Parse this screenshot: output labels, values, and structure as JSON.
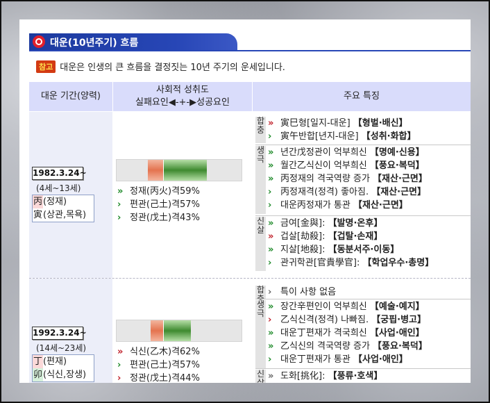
{
  "title": "대운(10년주기) 흐름",
  "note": {
    "badge": "참고",
    "text": "대운은 인생의 큰 흐름을 결정짓는 10년 주기의 운세입니다."
  },
  "headers": {
    "period": "대운 기간(양력)",
    "social_line1": "사회적 성취도",
    "social_line2": "실패요인◀-+-▶성공요인",
    "features": "주요 특징"
  },
  "colors": {
    "title_blue": "#2746b6",
    "header_bg": "#d9dcfb",
    "green": "#1f8a2a",
    "red": "#c0202a"
  },
  "decades": [
    {
      "date": "1982.3.24~",
      "age": "(4세~13세)",
      "pillars": [
        {
          "char": "丙",
          "rest": "(정재)",
          "char_bg": "#fbd9d9"
        },
        {
          "char": "寅",
          "rest": "(상관,목욕)",
          "char_bg": "#ffffff"
        }
      ],
      "achievement": {
        "fail_level": 0.12,
        "success_level": 0.55
      },
      "yukchin": [
        {
          "chev": "green2",
          "text": "정재(丙火)격59%"
        },
        {
          "chev": "green1",
          "text": "편관(己土)격57%"
        },
        {
          "chev": "green1",
          "text": "정관(戊土)격43%"
        }
      ],
      "groups": [
        {
          "label": [
            "합",
            "충"
          ],
          "rows": [
            {
              "chev": "red2",
              "text": "寅巳형[일지-대운] ",
              "tag": "【형벌·배신】"
            },
            {
              "chev": "green1",
              "text": "寅午반합[년지-대운] ",
              "tag": "【성취·화합】"
            }
          ]
        },
        {
          "label": [
            "생",
            "극"
          ],
          "rows": [
            {
              "chev": "green2",
              "text": "년간戊정관이 억부희신 ",
              "tag": "【명예·신용】"
            },
            {
              "chev": "green2",
              "text": "월간乙식신이 억부희신 ",
              "tag": "【풍요·복덕】"
            },
            {
              "chev": "green2",
              "text": "丙정재의 격국역량 증가 ",
              "tag": "【재산·근면】"
            },
            {
              "chev": "green1",
              "text": "丙정재격(정격) 좋아짐. ",
              "tag": "【재산·근면】"
            },
            {
              "chev": "green1",
              "text": "대운丙정재가 통관 ",
              "tag": "【재산·근면】"
            }
          ]
        },
        {
          "label": [
            "신",
            "살"
          ],
          "rows": [
            {
              "chev": "green2",
              "text": "금여[金與]: ",
              "tag": "【발명·온후】"
            },
            {
              "chev": "red2",
              "text": "겁살[劫殺]: ",
              "tag": "【겁탈·손재】"
            },
            {
              "chev": "green2",
              "text": "지살[地殺]: ",
              "tag": "【동분서주·이동】"
            },
            {
              "chev": "green1",
              "text": "관귀학관[官貴學官]: ",
              "tag": "【학업우수·총명】"
            }
          ]
        }
      ]
    },
    {
      "date": "1992.3.24~",
      "age": "(14세~23세)",
      "pillars": [
        {
          "char": "丁",
          "rest": "(편재)",
          "char_bg": "#fbd9d9"
        },
        {
          "char": "卯",
          "rest": "(식신,장생)",
          "char_bg": "#d7f1dc"
        }
      ],
      "achievement": {
        "fail_level": 0.1,
        "success_level": 0.35
      },
      "yukchin": [
        {
          "chev": "red2",
          "text": "식신(乙木)격62%"
        },
        {
          "chev": "green1",
          "text": "편관(己土)격57%"
        },
        {
          "chev": "red1",
          "text": "정관(戊土)격44%"
        }
      ],
      "groups": [
        {
          "label": [
            "합",
            "충"
          ],
          "rows": [
            {
              "chev": "gray1",
              "text": "특이 사항 없음",
              "tag": ""
            }
          ]
        },
        {
          "label": [
            "생",
            "극"
          ],
          "rows": [
            {
              "chev": "green2",
              "text": "장간辛편인이 억부희신 ",
              "tag": "【예술·예지】"
            },
            {
              "chev": "red1",
              "text": "乙식신격(정격) 나빠짐. ",
              "tag": "【궁핍·병고】"
            },
            {
              "chev": "green2",
              "text": "대운丁편재가 격국희신 ",
              "tag": "【사업·애인】"
            },
            {
              "chev": "green2",
              "text": "乙식신의 격국역량 증가 ",
              "tag": "【풍요·복덕】"
            },
            {
              "chev": "green1",
              "text": "대운丁편재가 통관 ",
              "tag": "【사업·애인】"
            }
          ]
        },
        {
          "label": [
            "신",
            "살"
          ],
          "rows": [
            {
              "chev": "gray2",
              "text": "도화[挑化]: ",
              "tag": "【풍류·호색】"
            }
          ]
        }
      ]
    }
  ]
}
